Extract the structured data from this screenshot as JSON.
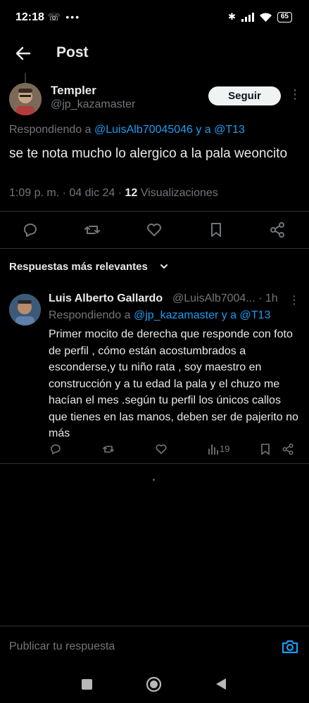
{
  "status_bar": {
    "time": "12:18",
    "battery": "65"
  },
  "header": {
    "title": "Post"
  },
  "post": {
    "author_name": "Templer",
    "author_handle": "@jp_kazamaster",
    "follow_label": "Seguir",
    "replying_prefix": "Respondiendo a",
    "replying_links": "@LuisAlb70045046 y a @T13",
    "text": "se te nota mucho lo alergico a la pala weoncito",
    "timestamp": "1:09 p. m. · 04 dic 24 · ",
    "views_count": "12",
    "views_label": " Visualizaciones"
  },
  "replies_section": {
    "label": "Respuestas más relevantes"
  },
  "reply": {
    "author_name": "Luis Alberto Gallardo",
    "author_handle": "@LuisAlb7004... · 1h",
    "replying_prefix": "Respondiendo a",
    "replying_links": "@jp_kazamaster y a @T13",
    "text": "Primer mocito de derecha que responde con foto de perfil , cómo están acostumbrados a esconderse,y tu niño rata , soy maestro en construcción y a tu edad la pala y el chuzo me hacían el mes .según tu perfil los únicos callos que tienes en las manos, deben ser de pajerito no más",
    "views": "19"
  },
  "compose": {
    "placeholder": "Publicar tu respuesta"
  },
  "colors": {
    "background": "#000000",
    "accent": "#1d9bf0",
    "muted": "#71767b",
    "text": "#e7e9ea"
  }
}
